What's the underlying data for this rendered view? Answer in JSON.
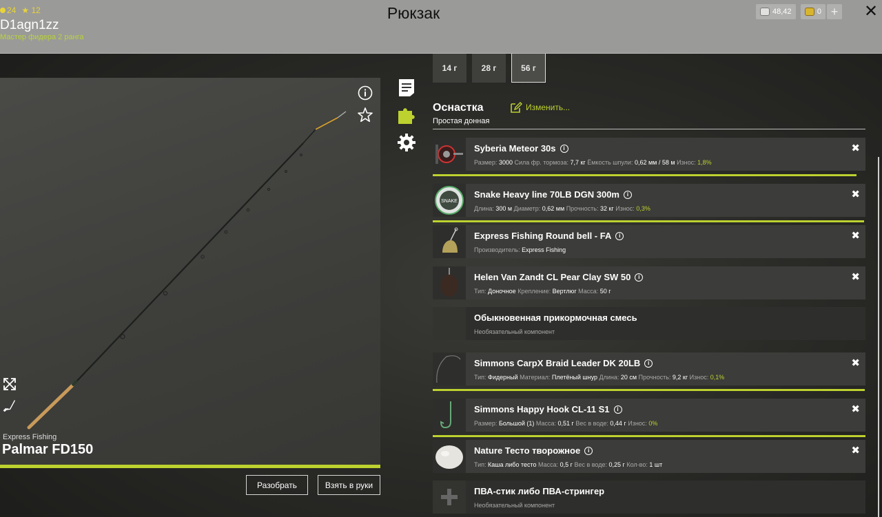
{
  "header": {
    "title": "Рюкзак",
    "stat_level": "24",
    "stat_stars": "12",
    "username": "D1agn1zz",
    "rank": "Мастер фидера 2 ранга",
    "silver": "48,42",
    "gold": "0",
    "plus_label": "+",
    "close_label": "✕"
  },
  "rod": {
    "brand": "Express Fishing",
    "name": "Palmar FD150",
    "disassemble_label": "Разобрать",
    "take_label": "Взять в руки",
    "durability": 1.0
  },
  "weight_tabs": [
    "14 г",
    "28 г",
    "56 г"
  ],
  "active_weight_tab": "56 г",
  "section": {
    "title": "Оснастка",
    "subtitle": "Простая донная",
    "edit_label": "Изменить..."
  },
  "colors": {
    "accent": "#bdd22e",
    "topbar": "#9a9a98"
  },
  "items": [
    {
      "name": "Syberia Meteor 30s",
      "icon": "reel",
      "stats": [
        {
          "label": "Размер:",
          "value": "3000"
        },
        {
          "label": "Сила фр. тормоза:",
          "value": "7,7 кг"
        },
        {
          "label": "Ёмкость шпули:",
          "value": "0,62 мм / 58 м"
        },
        {
          "label": "Износ:",
          "value": "1,8%",
          "accent": true
        }
      ],
      "durability": 0.98
    },
    {
      "name": "Snake Heavy line 70LB DGN 300m",
      "icon": "line-spool",
      "stats": [
        {
          "label": "Длина:",
          "value": "300 м"
        },
        {
          "label": "Диаметр:",
          "value": "0,62 мм"
        },
        {
          "label": "Прочность:",
          "value": "32 кг"
        },
        {
          "label": "Износ:",
          "value": "0,3%",
          "accent": true
        }
      ],
      "durability": 0.997
    },
    {
      "name": "Express Fishing Round bell - FA",
      "icon": "bell",
      "stats": [
        {
          "label": "Производитель:",
          "value": "Express Fishing"
        }
      ]
    },
    {
      "name": "Helen Van Zandt CL Pear Clay SW 50",
      "icon": "sinker",
      "stats": [
        {
          "label": "Тип:",
          "value": "Доночное"
        },
        {
          "label": "Крепление:",
          "value": "Вертлюг"
        },
        {
          "label": "Масса:",
          "value": "50 г"
        }
      ]
    },
    {
      "name": "Обыкновенная прикормочная смесь",
      "icon": "empty",
      "optional": true,
      "stats": [
        {
          "label": "Необязательный компонент",
          "value": ""
        }
      ]
    },
    {
      "name": "Simmons CarpX Braid Leader DK 20LB",
      "icon": "leader",
      "stats": [
        {
          "label": "Тип:",
          "value": "Фидерный"
        },
        {
          "label": "Материал:",
          "value": "Плетёный шнур"
        },
        {
          "label": "Длина:",
          "value": "20 см"
        },
        {
          "label": "Прочность:",
          "value": "9,2 кг"
        },
        {
          "label": "Износ:",
          "value": "0,1%",
          "accent": true
        }
      ],
      "durability": 0.999
    },
    {
      "name": "Simmons Happy Hook CL-11 S1",
      "icon": "hook",
      "stats": [
        {
          "label": "Размер:",
          "value": "Большой (1)"
        },
        {
          "label": "Масса:",
          "value": "0,51 г"
        },
        {
          "label": "Вес в воде:",
          "value": "0,44 г"
        },
        {
          "label": "Износ:",
          "value": "0%",
          "accent": true
        }
      ],
      "durability": 1.0
    },
    {
      "name": "Nature Тесто творожное",
      "icon": "dough-bait",
      "stats": [
        {
          "label": "Тип:",
          "value": "Каша либо тесто"
        },
        {
          "label": "Масса:",
          "value": "0,5 г"
        },
        {
          "label": "Вес в воде:",
          "value": "0,25 г"
        },
        {
          "label": "Кол-во:",
          "value": "1 шт"
        }
      ]
    },
    {
      "name": "ПВА-стик либо ПВА-стрингер",
      "icon": "add",
      "optional": true,
      "stats": [
        {
          "label": "Необязательный компонент",
          "value": ""
        }
      ]
    }
  ]
}
